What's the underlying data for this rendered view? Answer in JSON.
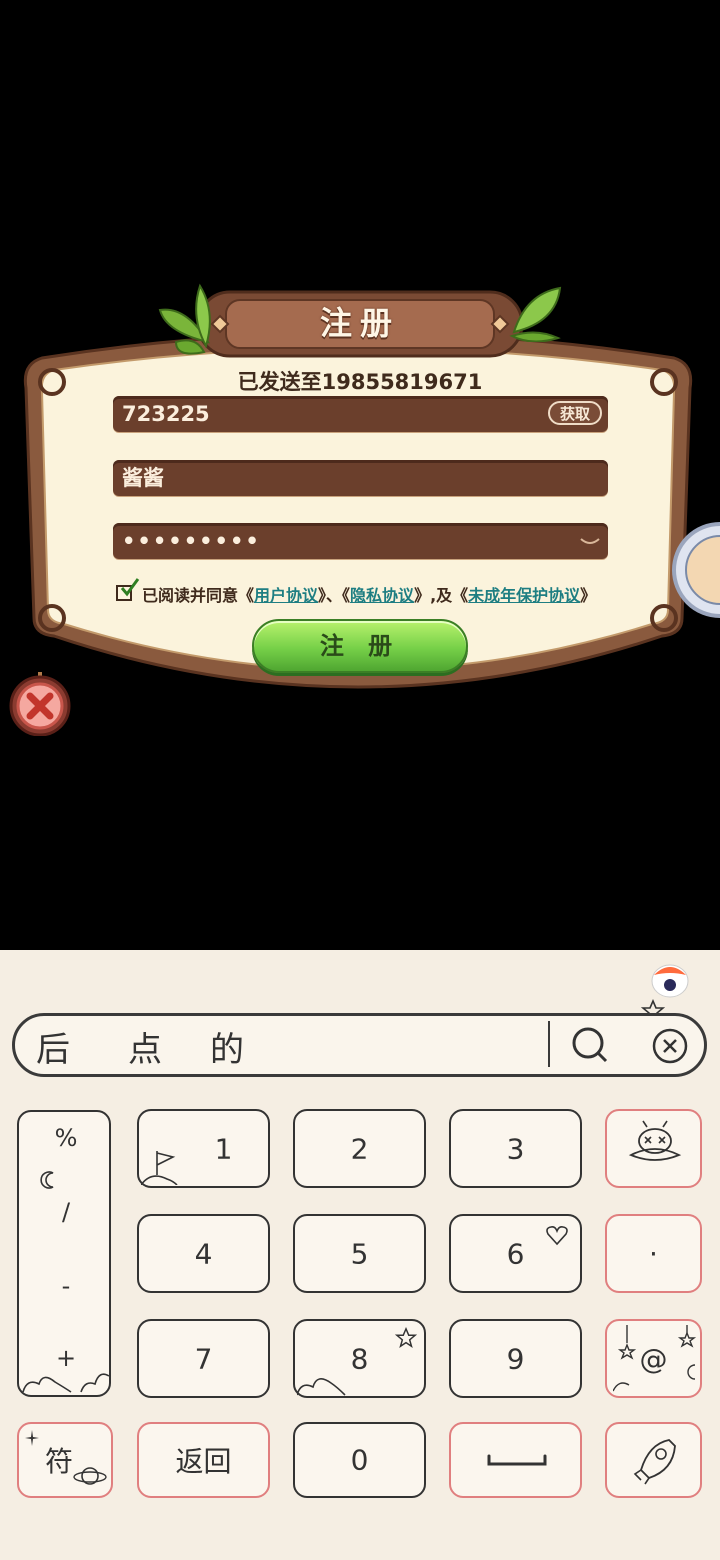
{
  "dialog": {
    "title": "注册",
    "sent_to": "已发送至19855819671",
    "code_value": "723225",
    "get_code_label": "获取",
    "nickname_value": "酱酱",
    "password_value": "•••••••••",
    "agreement": {
      "prefix": "已阅读并同意《",
      "user_agreement": "用户协议",
      "sep1": "》、《",
      "privacy_agreement": "隐私协议",
      "sep2": "》,及《",
      "minor_agreement": "未成年保护协议",
      "suffix": "》",
      "checked": true
    },
    "register_label": "注 册"
  },
  "keyboard": {
    "candidates": [
      "后",
      "点",
      "的"
    ],
    "symbols": [
      "%",
      "/",
      "-",
      "+"
    ],
    "keys": {
      "k1": "1",
      "k2": "2",
      "k3": "3",
      "k4": "4",
      "k5": "5",
      "k6": "6",
      "k7": "7",
      "k8": "8",
      "k9": "9",
      "k0": "0",
      "dot": "·",
      "at": "@",
      "fu": "符",
      "back": "返回"
    }
  },
  "colors": {
    "accent_green": "#76d048",
    "link_teal": "#1e7e82",
    "field_brown": "#6b3f2c",
    "key_red_border": "#e07f7f"
  }
}
